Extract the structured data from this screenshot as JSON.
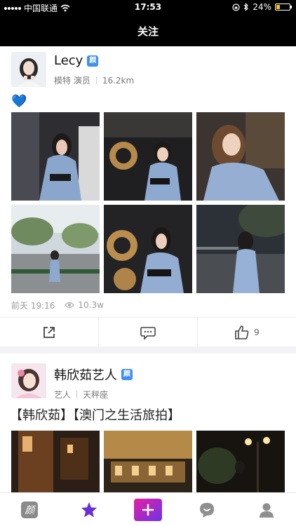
{
  "status_bar": {
    "carrier": "中国联通",
    "time": "17:53",
    "battery": "24%",
    "battery_level": 0.24
  },
  "nav": {
    "title": "关注"
  },
  "posts": [
    {
      "username": "Lecy",
      "badge": "颜",
      "tags": "模特 演员",
      "info": "16.2km",
      "caption": "💙",
      "time": "前天 19:16",
      "views": "10.3w",
      "likes": "9"
    },
    {
      "username": "韩欣茹艺人",
      "badge": "颜",
      "tags": "艺人",
      "info": "天秤座",
      "caption": "【韩欣茹】【澳门之生活旅拍】"
    }
  ],
  "tabbar": {
    "home_label": "颜",
    "colors": {
      "star": "#6a2fd8",
      "plus_start": "#e81fa0",
      "plus_end": "#6b34e8"
    },
    "icons": [
      "yan-logo-icon",
      "star-icon",
      "plus-icon",
      "chat-bubble-icon",
      "profile-icon"
    ]
  }
}
